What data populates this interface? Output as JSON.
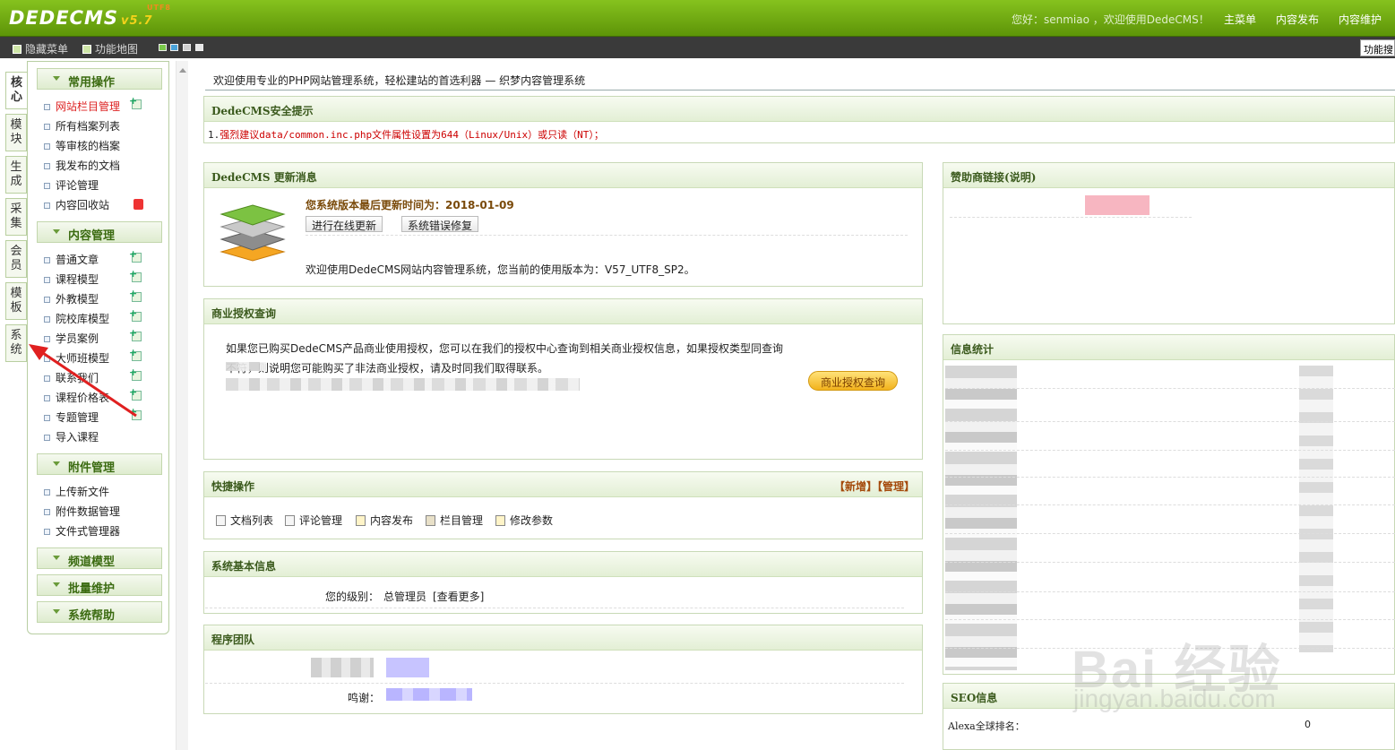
{
  "header": {
    "logo": "DEDECMS",
    "version": "v5.7",
    "version_sup": "UTF8",
    "welcome": "您好：senmiao ，欢迎使用DedeCMS！",
    "nav": [
      "主菜单",
      "内容发布",
      "内容维护"
    ]
  },
  "subbar": {
    "hide_menu": "隐藏菜单",
    "func_map": "功能地图",
    "search_label": "功能搜"
  },
  "left_tabs": [
    {
      "label": "核心",
      "active": true
    },
    {
      "label": "模块"
    },
    {
      "label": "生成"
    },
    {
      "label": "采集"
    },
    {
      "label": "会员"
    },
    {
      "label": "模板"
    },
    {
      "label": "系统"
    }
  ],
  "menu": {
    "common_title": "常用操作",
    "common_items": [
      "网站栏目管理",
      "所有档案列表",
      "等审核的档案",
      "我发布的文档",
      "评论管理",
      "内容回收站"
    ],
    "content_title": "内容管理",
    "content_items": [
      "普通文章",
      "课程模型",
      "外教模型",
      "院校库模型",
      "学员案例",
      "大师班模型",
      "联系我们",
      "课程价格表",
      "专题管理",
      "导入课程"
    ],
    "attach_title": "附件管理",
    "attach_items": [
      "上传新文件",
      "附件数据管理",
      "文件式管理器"
    ],
    "channel_title": "频道模型",
    "batch_title": "批量维护",
    "help_title": "系统帮助"
  },
  "main": {
    "intro": "欢迎使用专业的PHP网站管理系统，轻松建站的首选利器 — 织梦内容管理系统",
    "security": {
      "title": "DedeCMS安全提示",
      "prefix": "1.",
      "message": "强烈建议data/common.inc.php文件属性设置为644（Linux/Unix）或只读（NT）；"
    },
    "update": {
      "title": "DedeCMS 更新消息",
      "last_update": "您系统版本最后更新时间为：2018-01-09",
      "btn_online": "进行在线更新",
      "btn_fix": "系统错误修复",
      "desc": "欢迎使用DedeCMS网站内容管理系统，您当前的使用版本为：V57_UTF8_SP2。"
    },
    "biz": {
      "title": "商业授权查询",
      "text": "如果您已购买DedeCMS产品商业使用授权，您可以在我们的授权中心查询到相关商业授权信息，如果授权类型同查询不符，则说明您可能购买了非法商业授权，请及时同我们取得联系。",
      "button": "商业授权查询"
    },
    "quick": {
      "title": "快捷操作",
      "add": "【新增】",
      "manage": "【管理】",
      "links": [
        "文档列表",
        "评论管理",
        "内容发布",
        "栏目管理",
        "修改参数"
      ]
    },
    "sysinfo": {
      "title": "系统基本信息",
      "level_label": "您的级别：",
      "level_value": "总管理员",
      "more": "[查看更多]"
    },
    "team": {
      "title": "程序团队",
      "thanks_label": "鸣谢："
    },
    "sponsor": {
      "title": "赞助商链接",
      "note": "(说明)"
    },
    "stats": {
      "title": "信息统计"
    },
    "seo": {
      "title": "SEO信息",
      "alexa_label": "Alexa全球排名：",
      "alexa_value": "0"
    }
  },
  "watermark": {
    "brand": "Bai  经验",
    "url": "jingyan.baidu.com"
  },
  "colors": {
    "header_green": "#6fa612",
    "panel_border": "#c8d9b6",
    "alert_red": "#cc0000",
    "arrow_red": "#e02020"
  }
}
